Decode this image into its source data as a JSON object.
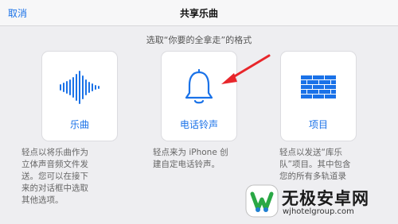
{
  "header": {
    "cancel_label": "取消",
    "title": "共享乐曲"
  },
  "subtitle": "选取“你要的全拿走”的格式",
  "accent_color": "#1a72e8",
  "arrow_color": "#e8262b",
  "options": [
    {
      "label": "乐曲",
      "icon": "waveform-icon",
      "description": [
        "轻点以将乐曲作为",
        "立体声音频文件发",
        "送。您可以在接下",
        "来的对话框中选取",
        "其他选项。"
      ]
    },
    {
      "label": "电话铃声",
      "icon": "bell-icon",
      "description": [
        "轻点来为 iPhone 创",
        "建自定电话铃声。"
      ]
    },
    {
      "label": "项目",
      "icon": "bricks-icon",
      "description": [
        "轻点以发送“库乐",
        "队”项目。其中包含",
        "您的所有多轨道录"
      ]
    }
  ],
  "watermark": {
    "title": "无极安卓网",
    "url": "wjhotelgroup.com"
  }
}
